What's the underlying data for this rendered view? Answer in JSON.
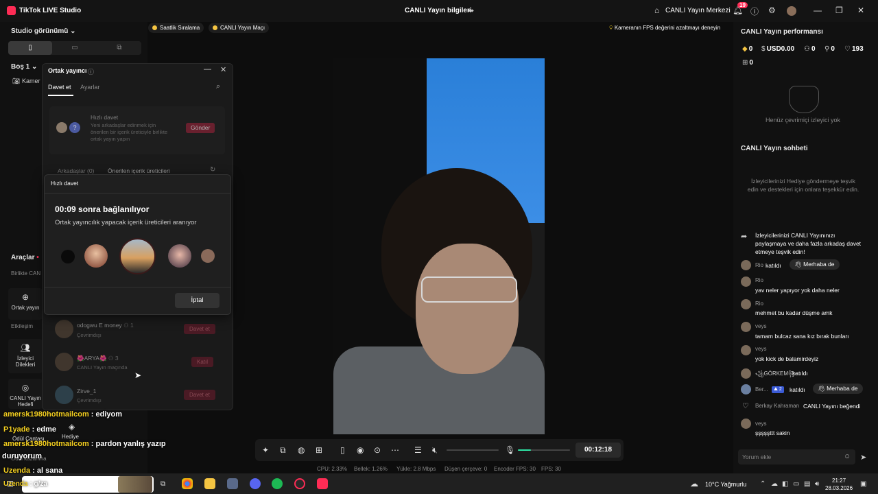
{
  "titlebar": {
    "app_title": "TikTok LIVE Studio",
    "center_title": "CANLI Yayın bilgileri",
    "center_link": "CANLI Yayın Merkezi",
    "notif_badge": "19"
  },
  "left": {
    "studio_view": "Studio görünümü",
    "scene": "Boş 1",
    "camera": "Kamer",
    "tools": "Araçlar",
    "birlikte": "Birlikte CAN",
    "cohost_tool": "Ortak yayın",
    "interaction": "Etkileşim",
    "viewer_wishes": "İzleyici Dilekleri",
    "live_goal": "CANLI Yayın Hedefi",
    "gift_bag": "Ödül Çantası",
    "gift_label": "Hediye",
    "gift_sub": "Ödül kazanma"
  },
  "top_pills": {
    "hourly": "Saatlik Sıralama",
    "match": "CANLI Yayın Maçı",
    "fps_tip": "Kameranın FPS değerini azaltmayı deneyin"
  },
  "cohost_panel": {
    "title": "Ortak yayıncı",
    "tab_invite": "Davet et",
    "tab_settings": "Ayarlar",
    "quick_title": "Hızlı davet",
    "quick_desc": "Yeni arkadaşlar edinmek için önerilen bir içerik üreticiyle birlikte ortak yayın yapın",
    "quick_btn": "Gönder",
    "friends_tab": "Arkadaşlar (0)",
    "suggested_tab": "Önerilen içerik üreticileri",
    "rows": [
      {
        "name": "odogwu E money",
        "count": "1",
        "sub": "Çevrimdışı",
        "btn": "Davet et"
      },
      {
        "name": "🌺ARYA🌺",
        "count": "3",
        "sub": "CANLI Yayın maçında",
        "btn": "Katıl"
      },
      {
        "name": "Zirve_1",
        "count": "",
        "sub": "Çevrimdışı",
        "btn": "Davet et"
      }
    ]
  },
  "modal": {
    "header": "Hızlı davet",
    "title": "00:09 sonra bağlanılıyor",
    "desc": "Ortak yayıncılık yapacak içerik üreticileri aranıyor",
    "cancel": "İptal"
  },
  "controls": {
    "timer": "00:12:18",
    "mic_level": 0.25
  },
  "stats": {
    "cpu": "CPU: 2.33%",
    "mem": "Bellek: 1.26%",
    "upload": "Yükle: 2.8 Mbps",
    "dropped": "Düşen çerçeve: 0",
    "enc_fps": "Encoder FPS: 30",
    "fps": "FPS: 30"
  },
  "right": {
    "perf_title": "CANLI Yayın performansı",
    "diamonds": "0",
    "usd": "USD0.00",
    "viewers": "0",
    "followers": "0",
    "likes": "193",
    "gifts": "0",
    "no_viewers": "Henüz çevrimiçi izleyici yok",
    "chat_title": "CANLI Yayın sohbeti",
    "chat_hint": "İzleyicilerinizi Hediye göndermeye teşvik edin ve destekleri için onlara teşekkür edin.",
    "share_msg": "İzleyicilerinizi CANLI Yayınınızı paylaşmaya ve daha fazla arkadaş davet etmeye teşvik edin!",
    "joined": "katıldı",
    "hello": "Merhaba de",
    "chats": [
      {
        "name": "Rio",
        "msg": "yav neler yapıyor yok daha neler"
      },
      {
        "name": "Rio",
        "msg": "mehmet bu kadar düşme amk"
      },
      {
        "name": "veys",
        "msg": "tamam bulcaz sana kız bırak bunları"
      },
      {
        "name": "veys",
        "msg": "yok kick de balamirdeyiz"
      }
    ],
    "gorkem": "꧁GÖRKEM꧂",
    "ber": "Ber...",
    "ber_badge": "2",
    "berkay": "Berkay Kahraman",
    "liked": "CANLI Yayını beğendi",
    "last_name": "veys",
    "last_msg": "şşşşşttt sakin",
    "comment_ph": "Yorum ekle"
  },
  "overlay_chat": [
    {
      "user": "amersk1980hotmailcom",
      "msg": ": ediyom"
    },
    {
      "user": "P1yade",
      "msg": ": edme"
    },
    {
      "user": "amersk1980hotmailcom",
      "msg": ": pardon yanlış yazıp"
    },
    {
      "user": "",
      "msg": "duruyorum"
    },
    {
      "user": "Uzenda",
      "msg": ": al sana"
    },
    {
      "user": "Uzenda",
      "msg": ": g/za"
    }
  ],
  "taskbar": {
    "weather": "10°C Yağmurlu",
    "time": "21:27",
    "date": "28.03.2026"
  }
}
